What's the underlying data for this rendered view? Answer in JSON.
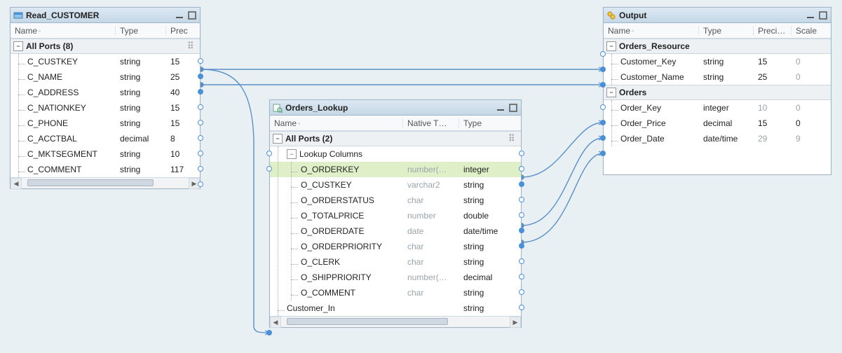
{
  "panels": {
    "read": {
      "title": "Read_CUSTOMER",
      "header": {
        "c0": "Name",
        "c1": "Type",
        "c2": "Prec"
      },
      "group": {
        "label": "All Ports (8)"
      },
      "rows": [
        {
          "name": "C_CUSTKEY",
          "type": "string",
          "prec": "15"
        },
        {
          "name": "C_NAME",
          "type": "string",
          "prec": "25"
        },
        {
          "name": "C_ADDRESS",
          "type": "string",
          "prec": "40"
        },
        {
          "name": "C_NATIONKEY",
          "type": "string",
          "prec": "15"
        },
        {
          "name": "C_PHONE",
          "type": "string",
          "prec": "15"
        },
        {
          "name": "C_ACCTBAL",
          "type": "decimal",
          "prec": "8"
        },
        {
          "name": "C_MKTSEGMENT",
          "type": "string",
          "prec": "10"
        },
        {
          "name": "C_COMMENT",
          "type": "string",
          "prec": "117"
        }
      ]
    },
    "lookup": {
      "title": "Orders_Lookup",
      "header": {
        "c0": "Name",
        "c1": "Native T…",
        "c2": "Type"
      },
      "group": {
        "label": "All Ports (2)"
      },
      "subgroup": {
        "label": "Lookup Columns"
      },
      "rows": [
        {
          "name": "O_ORDERKEY",
          "native": "number(…",
          "type": "integer",
          "highlight": true
        },
        {
          "name": "O_CUSTKEY",
          "native": "varchar2",
          "type": "string"
        },
        {
          "name": "O_ORDERSTATUS",
          "native": "char",
          "type": "string"
        },
        {
          "name": "O_TOTALPRICE",
          "native": "number",
          "type": "double"
        },
        {
          "name": "O_ORDERDATE",
          "native": "date",
          "type": "date/time"
        },
        {
          "name": "O_ORDERPRIORITY",
          "native": "char",
          "type": "string"
        },
        {
          "name": "O_CLERK",
          "native": "char",
          "type": "string"
        },
        {
          "name": "O_SHIPPRIORITY",
          "native": "number(…",
          "type": "decimal"
        },
        {
          "name": "O_COMMENT",
          "native": "char",
          "type": "string"
        }
      ],
      "extra": {
        "name": "Customer_In",
        "native": "",
        "type": "string"
      }
    },
    "output": {
      "title": "Output",
      "header": {
        "c0": "Name",
        "c1": "Type",
        "c2": "Preci…",
        "c3": "Scale"
      },
      "group1": {
        "label": "Orders_Resource"
      },
      "rows1": [
        {
          "name": "Customer_Key",
          "type": "string",
          "prec": "15",
          "scale": "0"
        },
        {
          "name": "Customer_Name",
          "type": "string",
          "prec": "25",
          "scale": "0"
        }
      ],
      "group2": {
        "label": "Orders"
      },
      "rows2": [
        {
          "name": "Order_Key",
          "type": "integer",
          "prec": "10",
          "scale": "0"
        },
        {
          "name": "Order_Price",
          "type": "decimal",
          "prec": "15",
          "scale": "0"
        },
        {
          "name": "Order_Date",
          "type": "date/time",
          "prec": "29",
          "scale": "9"
        }
      ]
    }
  }
}
